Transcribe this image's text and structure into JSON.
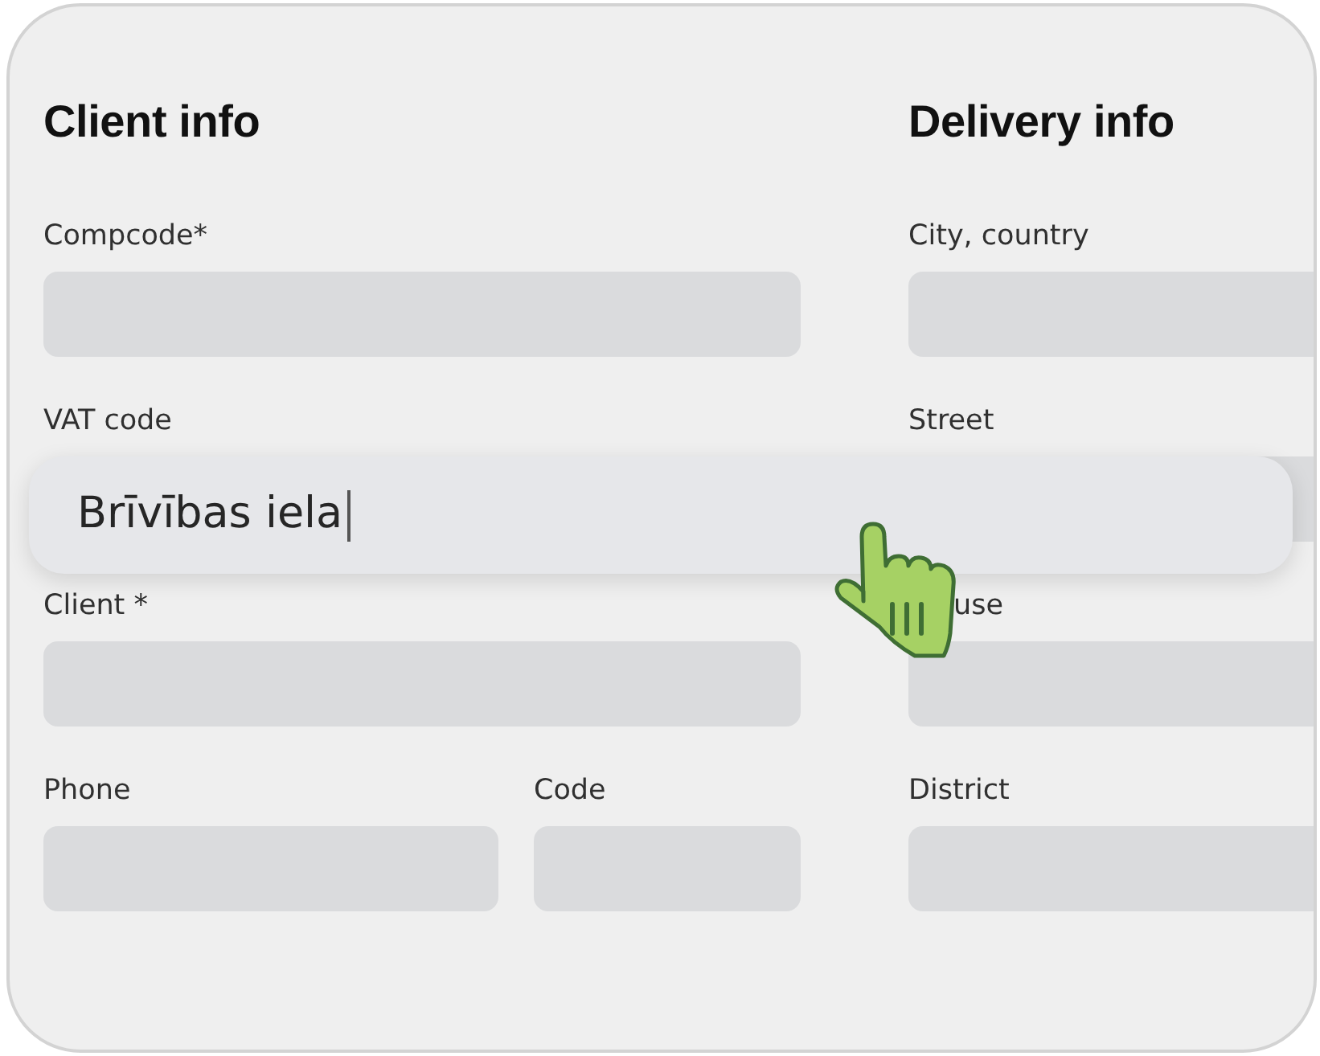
{
  "client_info": {
    "title": "Client info",
    "rows": [
      [
        {
          "label": "Compcode*"
        }
      ],
      [
        {
          "label": "VAT code",
          "obscured": true
        }
      ],
      [
        {
          "label": "Client *"
        }
      ],
      [
        {
          "label": "Phone"
        },
        {
          "label": "Code"
        }
      ]
    ]
  },
  "delivery_info": {
    "title": "Delivery info",
    "rows": [
      [
        {
          "label": "City, country"
        }
      ],
      [
        {
          "label": "Street"
        }
      ],
      [
        {
          "label": "use",
          "pointer_over": true
        }
      ],
      [
        {
          "label": "District"
        }
      ]
    ]
  },
  "floating_input": {
    "value": "Brīvības iela",
    "focused": true
  }
}
